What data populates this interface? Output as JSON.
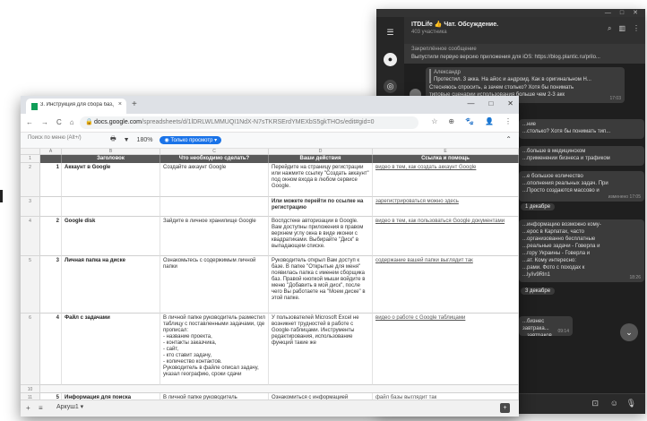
{
  "telegram": {
    "title": "ITDLife 👍 Чат. Обсуждение.",
    "subtitle": "403 участника",
    "header_icons": [
      "search-icon",
      "columns-icon",
      "more-icon"
    ],
    "window_controls": [
      "—",
      "□",
      "✕"
    ],
    "rail_icons": [
      "menu-icon",
      "chat-icon",
      "archive-icon"
    ],
    "pinned": {
      "heading": "Закреплённое сообщение",
      "text": "Выпустили первую версию приложения для iOS: https://blog.plantic.ru/prilo..."
    },
    "messages": [
      {
        "reply_name": "Александр",
        "reply_text": "Протестил. 3 акка. На айос и андроид. Как в оригинальном Н...",
        "text": "Стесняюсь спросить, а зачем столько? Хотя бы понимать\nтиповые сценарии использования больше чем 2-3 акк",
        "time": "17:03"
      },
      {
        "reply_name": "",
        "reply_text": "",
        "text": "...ние\n...столько? Хотя бы понимать тип...",
        "time": ""
      },
      {
        "reply_name": "",
        "reply_text": "",
        "text": "...больше в медицинском\n...применении бизнеса и трафиком",
        "time": ""
      },
      {
        "reply_name": "",
        "reply_text": "",
        "text": "...е большое количество\n...ополнения реальных задач. При\n...Просто создаются массово и",
        "time": "изменено 17:05"
      }
    ],
    "date_1": "1 декабре",
    "messages_2": [
      {
        "text": "...информацию возможно кому-\n...ерос в Карпатах, часто\n...организованно бесплатные\n...реальные задачи - Говерла и\n...гору Украины - Говерла и\n...ат. Кому интересно:\n...рами. Фото с походах к\n...ly/iv9Rln1",
        "time": "18:26"
      }
    ],
    "date_2": "3 декабре",
    "messages_3": [
      {
        "text": "...бизнес завтрака...\n...завтраков",
        "time": "09:14"
      }
    ],
    "input_icons": [
      "sticker-icon",
      "emoji-icon",
      "mic-icon"
    ],
    "scroll_down": "⌄"
  },
  "chrome": {
    "tab_title": "3. Инструкция для сбора баз.д",
    "new_tab": "+",
    "window_controls": [
      "—",
      "□",
      "✕"
    ],
    "nav": [
      "←",
      "→",
      "C",
      "⌂"
    ],
    "url_host": "docs.google.com",
    "url_path": "/spreadsheets/d/1lDRLWLMMUQI1NdX-N7sTKRSErdYMEXbS5gkTHOs/edit#gid=0",
    "toolbar_icons": [
      "☆",
      "⊕",
      "🐾",
      "👤",
      "⋮"
    ]
  },
  "sheet": {
    "search_placeholder": "Поиск по меню (Alt+/)",
    "zoom": "180%",
    "print_icon": "🖶",
    "filter_icon": "▼",
    "view_only": "◉ Только просмотр ▾",
    "collapse": "⌃",
    "col_letters": [
      "A",
      "B",
      "C",
      "D",
      "E"
    ],
    "headers": [
      "",
      "Заголовок",
      "Что необходимо сделать?",
      "Ваши действия",
      "Ссылка и помощь"
    ],
    "rows": [
      {
        "num": "1",
        "task": "Аккаунт в Google",
        "todo": "Создайте аккаунт Google",
        "action": "Перейдите на страницу регистрации или нажмите ссылку \"Создать аккаунт\" под окном входа в любом сервисе Google.",
        "link": "видео в тем, как создать аккаунт Google"
      },
      {
        "num": "",
        "task": "",
        "todo": "",
        "action": "Или можете перейти по ссылке на регистрацию",
        "link": "зарегистрироваться можно здесь"
      },
      {
        "num": "2",
        "task": "Google disk",
        "todo": "Зайдите в личное хранилище Google",
        "action": "Воспдстеке авторизации в Google. Вам доступны приложения в правом верхнем углу окна в виде иконки с квадратиками. Выбирайте \"Диск\" в выпадающем списке.",
        "link": "видео в тем, как пользоваться Google документами"
      },
      {
        "num": "3",
        "task": "Личная папка на диске",
        "todo": "Ознакомьтесь с содержимым личной папки",
        "action": "Руководитель открыл Вам доступ к базе. В папке \"Открытые для меня\" появилась папка с именем сборщика баз. Правой кнопкой мыши войдите в меню \"Добавить в мой диск\", после чего Вы работаете на \"Моем диске\" в этой папке.",
        "link": "содержание вашей папки выглядит так"
      },
      {
        "num": "4",
        "task": "Файл с задачами",
        "todo": "В личной папке руководитель разместил таблицу с поставленными задачами, где прописал:\n- название проекта,\n- контакты заказчика,\n- сайт,\n- кто ставит задачу,\n- количество контактов.\nРуководитель в файле описал задачу, указал географию, сроки сдачи",
        "action": "У пользователей Microsoft Excel не возникнет трудностей в работе с Google-таблицами. Инструменты редактирования, использование функций такие же",
        "link": "видео о работе с Google таблицами"
      },
      {
        "num": "5",
        "task": "Информация для поиска",
        "todo": "В личной папке руководитель",
        "action": "Ознакомиться с информацией",
        "link": "файл базы выглядит так"
      }
    ],
    "row_numbers": [
      "1",
      "2",
      "3",
      "4",
      "5",
      "6",
      "7",
      "8",
      "9",
      "10",
      "11"
    ],
    "sheet_tab": "Аркуш1 ▾",
    "add_sheet": "+",
    "sheets_menu": "≡",
    "explore": "+"
  }
}
